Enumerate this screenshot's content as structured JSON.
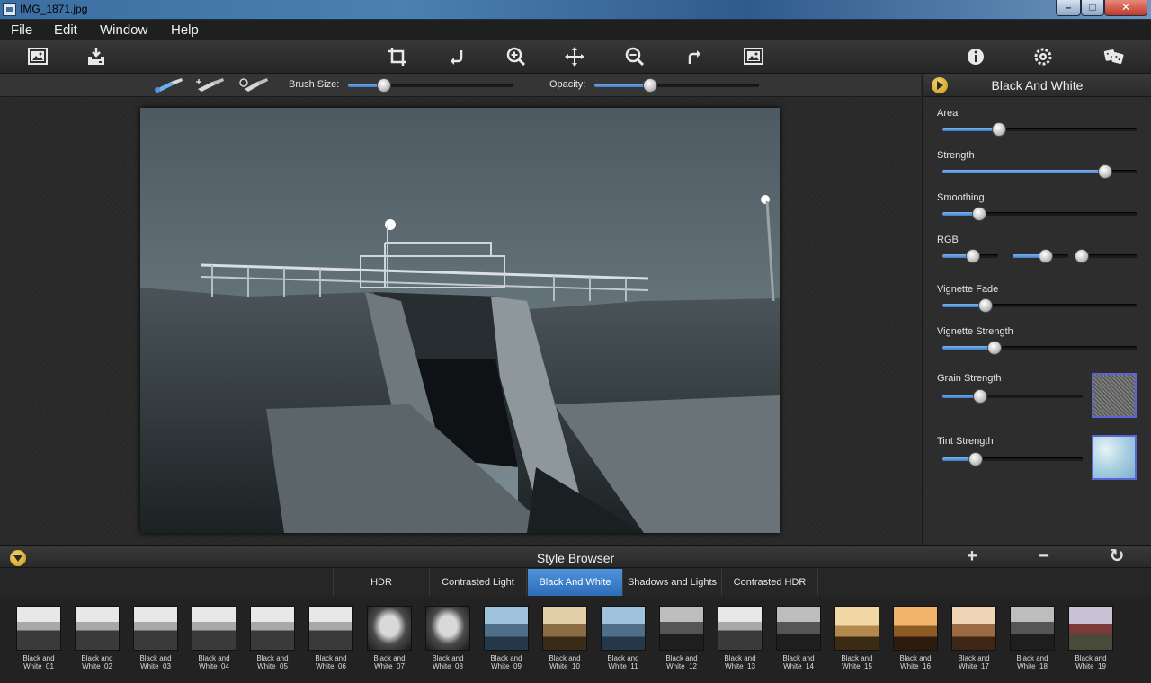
{
  "window": {
    "title": "IMG_1871.jpg",
    "minimize": "–",
    "maximize": "□",
    "close": "✕"
  },
  "menu": [
    "File",
    "Edit",
    "Window",
    "Help"
  ],
  "toolbar": {
    "icons": [
      "open-image-icon",
      "save-icon",
      "crop-icon",
      "rotate-left-icon",
      "zoom-in-icon",
      "pan-icon",
      "zoom-out-icon",
      "rotate-right-icon",
      "fit-image-icon",
      "info-icon",
      "settings-icon",
      "random-dice-icon"
    ]
  },
  "brush": {
    "brush_size_label": "Brush Size:",
    "brush_size_value": 0.22,
    "opacity_label": "Opacity:",
    "opacity_value": 0.34
  },
  "panel": {
    "title": "Black And White",
    "controls": {
      "area": {
        "label": "Area",
        "value": 0.29
      },
      "strength": {
        "label": "Strength",
        "value": 0.84
      },
      "smoothing": {
        "label": "Smoothing",
        "value": 0.19
      },
      "rgb": {
        "label": "RGB",
        "r": 0.55,
        "g": 0.6,
        "b": 0.05
      },
      "vignette_fade": {
        "label": "Vignette Fade",
        "value": 0.22
      },
      "vignette_strength": {
        "label": "Vignette Strength",
        "value": 0.27
      },
      "grain_strength": {
        "label": "Grain Strength",
        "value": 0.27
      },
      "tint_strength": {
        "label": "Tint Strength",
        "value": 0.24
      }
    }
  },
  "style_browser": {
    "title": "Style Browser",
    "add": "+",
    "remove": "−",
    "reset": "↻",
    "tabs": [
      "HDR",
      "Contrasted Light",
      "Black And White",
      "Shadows and Lights",
      "Contrasted HDR"
    ],
    "active_tab": "Black And White",
    "thumbnails": [
      {
        "line1": "Black and",
        "line2": "White_01",
        "style": "t-bw"
      },
      {
        "line1": "Black and",
        "line2": "White_02",
        "style": "t-bw"
      },
      {
        "line1": "Black and",
        "line2": "White_03",
        "style": "t-bw"
      },
      {
        "line1": "Black and",
        "line2": "White_04",
        "style": "t-bw"
      },
      {
        "line1": "Black and",
        "line2": "White_05",
        "style": "t-bw"
      },
      {
        "line1": "Black and",
        "line2": "White_06",
        "style": "t-bw"
      },
      {
        "line1": "Black and",
        "line2": "White_07",
        "style": "t-face"
      },
      {
        "line1": "Black and",
        "line2": "White_08",
        "style": "t-face"
      },
      {
        "line1": "Black and",
        "line2": "White_09",
        "style": "t-blue"
      },
      {
        "line1": "Black and",
        "line2": "White_10",
        "style": "t-sepia"
      },
      {
        "line1": "Black and",
        "line2": "White_11",
        "style": "t-blue"
      },
      {
        "line1": "Black and",
        "line2": "White_12",
        "style": "t-dark"
      },
      {
        "line1": "Black and",
        "line2": "White_13",
        "style": "t-bw"
      },
      {
        "line1": "Black and",
        "line2": "White_14",
        "style": "t-dark"
      },
      {
        "line1": "Black and",
        "line2": "White_15",
        "style": "t-gold"
      },
      {
        "line1": "Black and",
        "line2": "White_16",
        "style": "t-orange"
      },
      {
        "line1": "Black and",
        "line2": "White_17",
        "style": "t-warm"
      },
      {
        "line1": "Black and",
        "line2": "White_18",
        "style": "t-dark"
      },
      {
        "line1": "Black and",
        "line2": "White_19",
        "style": "t-pink"
      }
    ]
  },
  "colors": {
    "accent_blue": "#3f7fc8",
    "toggle_gold": "#e0b43a",
    "swatch_border": "#5b63d8"
  }
}
